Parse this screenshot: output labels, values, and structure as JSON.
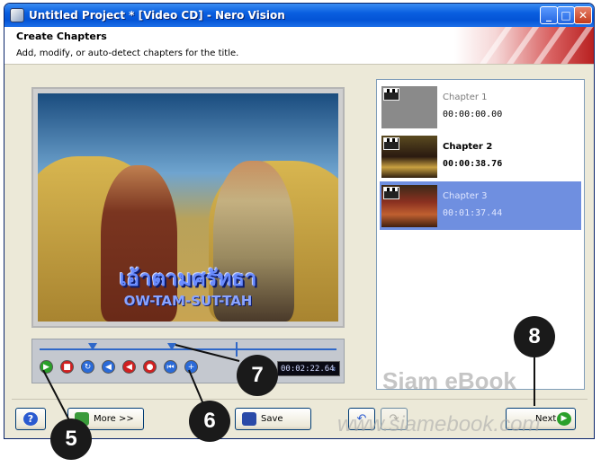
{
  "window": {
    "title": "Untitled Project * [Video CD] - Nero Vision",
    "minimize_glyph": "_",
    "maximize_glyph": "□",
    "close_glyph": "✕"
  },
  "header": {
    "title": "Create Chapters",
    "subtitle": "Add, modify, or auto-detect chapters for the title."
  },
  "video": {
    "caption_thai": "เอ้าตามศรัทธา",
    "caption_roman": "OW-TAM-SUT-TAH"
  },
  "timeline": {
    "timecode": "00:02:22.64",
    "controls": [
      "play-icon",
      "stop-icon",
      "loop-icon",
      "step-back-icon",
      "remove-chapter-icon",
      "record-icon",
      "prev-chapter-icon",
      "add-chapter-icon"
    ]
  },
  "chapters": [
    {
      "name": "Chapter 1",
      "time": "00:00:00.00",
      "selected": false
    },
    {
      "name": "Chapter 2",
      "time": "00:00:38.76",
      "selected": false
    },
    {
      "name": "Chapter 3",
      "time": "00:01:37.44",
      "selected": true
    }
  ],
  "buttons": {
    "help": "?",
    "more": "More >>",
    "save": "Save",
    "next": "Next"
  },
  "watermark": {
    "line1": "Siam eBook",
    "line2": "www.siamebook.com"
  },
  "callouts": [
    "5",
    "6",
    "7",
    "8"
  ],
  "colors": {
    "titlebar": "#0454d6",
    "selection": "#6f8fe0",
    "timeline_track": "#2f67c8"
  }
}
